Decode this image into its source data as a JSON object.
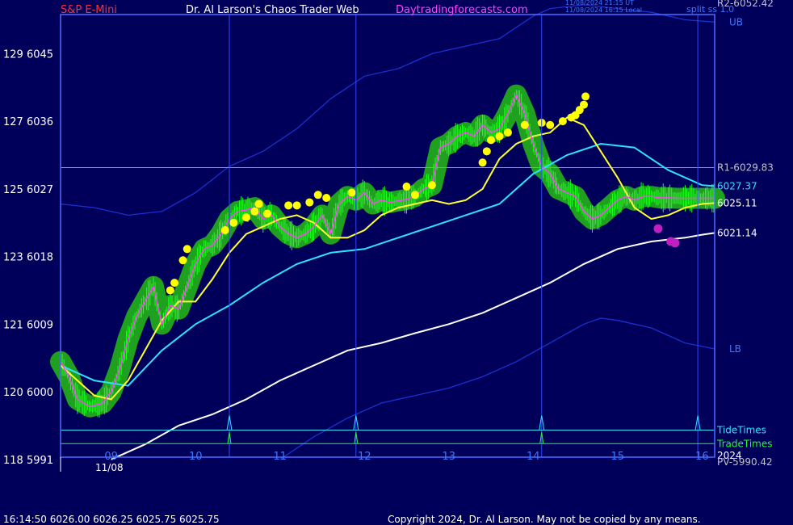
{
  "header": {
    "symbol": "S&P E-Mini",
    "title": "Dr. Al Larson's Chaos Trader Web",
    "site": "Daytradingforecasts.com",
    "time_utc": "11/08/2024 21:15 UT",
    "time_local": "11/08/2024 16:15 Local",
    "split_label": "split ss 1.0"
  },
  "footer": {
    "quote": "16:14:50  6026.00 6026.25 6025.75 6025.75",
    "copyright": "Copyright 2024, Dr. Al Larson. May not be copied by any means."
  },
  "colors": {
    "background": "#00005a",
    "plot_border": "#4a6cff",
    "price": "#ff40ff",
    "price_fast_ma": "#ffff30",
    "mid_ma": "#30e0ff",
    "slow_ma": "#ffffff",
    "band": "#1a30d0",
    "green_zone": "#1fa01f",
    "green_bars": "#20ff20",
    "yellow_dots": "#ffff00",
    "purple_dots": "#c020c0",
    "tide_times": "#30e0ff",
    "trade_times": "#20ff20",
    "r1_line": "#8090ff",
    "time_lines": "#3048ff"
  },
  "chart_data": {
    "type": "line",
    "date_label": "11/08",
    "x_hours": [
      "09",
      "10",
      "11",
      "12",
      "13",
      "14",
      "15",
      "16"
    ],
    "y_axis": {
      "ticks": [
        {
          "value": 5991,
          "label": "118  5991"
        },
        {
          "value": 6000,
          "label": "120  6000"
        },
        {
          "value": 6009,
          "label": "121  6009"
        },
        {
          "value": 6018,
          "label": "123  6018"
        },
        {
          "value": 6027,
          "label": "125  6027"
        },
        {
          "value": 6036,
          "label": "127  6036"
        },
        {
          "value": 6045,
          "label": "129  6045"
        }
      ],
      "min": 5991.3,
      "max": 6050.2
    },
    "x_range": [
      8.4,
      16.15
    ],
    "right_labels": [
      {
        "text": "R2-6052.42",
        "value": 6052.42,
        "color": "#c0c0c0"
      },
      {
        "text": "UB",
        "value": 6049.2,
        "color": "#3a78ff"
      },
      {
        "text": "R1-6029.83",
        "value": 6029.83,
        "color": "#c0c0c0"
      },
      {
        "text": "6027.37",
        "value": 6027.37,
        "color": "#30e0ff"
      },
      {
        "text": "6025.11",
        "value": 6025.11,
        "color": "#ffffff"
      },
      {
        "text": "6021.14",
        "value": 6021.14,
        "color": "#ffffff"
      },
      {
        "text": "LB",
        "value": 6005.7,
        "color": "#3a78ff"
      },
      {
        "text": "TideTimes",
        "value": 5994.9,
        "color": "#30e0ff"
      },
      {
        "text": "TradeTimes",
        "value": 5993.1,
        "color": "#20ff20"
      },
      {
        "text": "2024",
        "value": 5991.5,
        "color": "#ffffff"
      },
      {
        "text": "PV-5990.42",
        "value": 5990.42,
        "color": "#c0c0c0"
      }
    ],
    "reference_lines": [
      {
        "name": "R1",
        "value": 6029.83
      }
    ],
    "vertical_time_lines": [
      10.4,
      11.9,
      14.1,
      15.95
    ],
    "tide_times": [
      10.4,
      11.9,
      14.1,
      15.95
    ],
    "trade_times": [
      10.4,
      11.9,
      14.1
    ],
    "series": [
      {
        "key": "price",
        "x": [
          8.4,
          8.5,
          8.6,
          8.75,
          8.9,
          9.0,
          9.1,
          9.2,
          9.3,
          9.4,
          9.5,
          9.6,
          9.7,
          9.8,
          9.9,
          10.0,
          10.1,
          10.2,
          10.3,
          10.4,
          10.5,
          10.6,
          10.7,
          10.8,
          10.9,
          11.0,
          11.1,
          11.2,
          11.3,
          11.4,
          11.5,
          11.6,
          11.7,
          11.8,
          11.9,
          12.0,
          12.1,
          12.2,
          12.3,
          12.4,
          12.5,
          12.6,
          12.7,
          12.8,
          12.9,
          13.0,
          13.1,
          13.2,
          13.3,
          13.4,
          13.5,
          13.6,
          13.7,
          13.8,
          13.9,
          14.0,
          14.1,
          14.2,
          14.3,
          14.4,
          14.5,
          14.6,
          14.7,
          14.8,
          14.9,
          15.0,
          15.1,
          15.2,
          15.3,
          15.4,
          15.5,
          15.6,
          15.7,
          15.8,
          15.9,
          16.0,
          16.1,
          16.15
        ],
        "y": [
          6004.0,
          6002.0,
          5999.0,
          5998.0,
          5998.5,
          6000.0,
          6003.0,
          6007.0,
          6010.0,
          6012.0,
          6014.0,
          6009.0,
          6011.5,
          6011.0,
          6014.0,
          6017.0,
          6019.0,
          6019.5,
          6021.0,
          6023.0,
          6024.0,
          6024.2,
          6024.5,
          6023.0,
          6023.5,
          6022.0,
          6021.0,
          6020.5,
          6021.0,
          6022.0,
          6023.5,
          6021.0,
          6025.0,
          6026.0,
          6025.5,
          6026.5,
          6025.0,
          6025.5,
          6025.2,
          6025.4,
          6025.6,
          6026.0,
          6027.0,
          6027.5,
          6032.5,
          6033.0,
          6034.0,
          6034.5,
          6034.0,
          6035.5,
          6034.5,
          6035.0,
          6037.0,
          6039.5,
          6037.0,
          6033.0,
          6030.0,
          6029.0,
          6027.0,
          6026.5,
          6026.0,
          6024.0,
          6023.0,
          6023.5,
          6024.5,
          6025.5,
          6026.0,
          6025.5,
          6026.0,
          6026.0,
          6025.8,
          6025.8,
          6025.75,
          6025.75,
          6025.75,
          6025.75,
          6025.75,
          6025.75
        ]
      },
      {
        "key": "fast_ma",
        "x": [
          8.4,
          8.6,
          8.8,
          9.0,
          9.2,
          9.4,
          9.6,
          9.8,
          10.0,
          10.2,
          10.4,
          10.6,
          10.8,
          11.0,
          11.2,
          11.4,
          11.6,
          11.8,
          12.0,
          12.2,
          12.4,
          12.6,
          12.8,
          13.0,
          13.2,
          13.4,
          13.6,
          13.8,
          14.0,
          14.2,
          14.4,
          14.6,
          14.8,
          15.0,
          15.2,
          15.4,
          15.6,
          15.8,
          16.0,
          16.15
        ],
        "y": [
          6003.5,
          6001.5,
          5999.5,
          5999.0,
          6001.5,
          6005.5,
          6009.5,
          6012.0,
          6012.0,
          6015.0,
          6018.5,
          6021.0,
          6022.0,
          6023.0,
          6023.5,
          6022.5,
          6020.5,
          6020.5,
          6021.5,
          6023.5,
          6024.5,
          6025.0,
          6025.5,
          6025.0,
          6025.5,
          6027.0,
          6031.0,
          6033.0,
          6034.0,
          6034.5,
          6036.5,
          6035.5,
          6032.0,
          6028.5,
          6024.5,
          6023.0,
          6023.5,
          6024.5,
          6025.0,
          6025.11
        ]
      },
      {
        "key": "mid_ma",
        "x": [
          8.4,
          8.8,
          9.2,
          9.6,
          10.0,
          10.4,
          10.8,
          11.2,
          11.6,
          12.0,
          12.4,
          12.8,
          13.2,
          13.6,
          14.0,
          14.4,
          14.8,
          15.2,
          15.6,
          16.0,
          16.15
        ],
        "y": [
          6003.5,
          6001.5,
          6000.8,
          6005.5,
          6009.0,
          6011.5,
          6014.5,
          6017.0,
          6018.5,
          6019.0,
          6020.5,
          6022.0,
          6023.5,
          6025.0,
          6029.0,
          6031.5,
          6033.0,
          6032.5,
          6029.5,
          6027.5,
          6027.37
        ]
      },
      {
        "key": "slow_ma",
        "x": [
          9.0,
          9.4,
          9.8,
          10.2,
          10.6,
          11.0,
          11.4,
          11.8,
          12.2,
          12.6,
          13.0,
          13.4,
          13.8,
          14.2,
          14.6,
          15.0,
          15.4,
          15.8,
          16.0,
          16.15
        ],
        "y": [
          5991.0,
          5993.0,
          5995.5,
          5997.0,
          5999.0,
          6001.5,
          6003.5,
          6005.5,
          6006.5,
          6007.8,
          6009.0,
          6010.5,
          6012.5,
          6014.5,
          6017.0,
          6019.0,
          6020.0,
          6020.5,
          6020.9,
          6021.14
        ]
      },
      {
        "key": "upper_band",
        "x": [
          8.4,
          8.8,
          9.2,
          9.6,
          10.0,
          10.4,
          10.8,
          11.2,
          11.6,
          12.0,
          12.4,
          12.8,
          13.2,
          13.6,
          14.0,
          14.2,
          14.6,
          15.0,
          15.4,
          15.8,
          16.15
        ],
        "y": [
          6025.0,
          6024.5,
          6023.5,
          6024.0,
          6026.5,
          6030.0,
          6032.0,
          6035.0,
          6039.0,
          6042.0,
          6043.0,
          6045.0,
          6046.0,
          6047.0,
          6050.0,
          6051.0,
          6051.5,
          6051.0,
          6050.5,
          6049.5,
          6049.2
        ]
      },
      {
        "key": "lower_band",
        "x": [
          11.0,
          11.4,
          11.8,
          12.2,
          12.6,
          13.0,
          13.4,
          13.8,
          14.2,
          14.6,
          14.8,
          15.0,
          15.4,
          15.8,
          16.15
        ],
        "y": [
          5991.0,
          5994.0,
          5996.5,
          5998.5,
          5999.5,
          6000.5,
          6002.0,
          6004.0,
          6006.5,
          6009.0,
          6009.8,
          6009.5,
          6008.5,
          6006.5,
          6005.7
        ]
      }
    ],
    "yellow_dots": [
      {
        "x": 9.7,
        "y": 6013.5
      },
      {
        "x": 9.75,
        "y": 6014.5
      },
      {
        "x": 9.85,
        "y": 6017.5
      },
      {
        "x": 9.9,
        "y": 6019.0
      },
      {
        "x": 10.35,
        "y": 6021.5
      },
      {
        "x": 10.45,
        "y": 6022.5
      },
      {
        "x": 10.6,
        "y": 6023.2
      },
      {
        "x": 10.7,
        "y": 6024.0
      },
      {
        "x": 10.75,
        "y": 6025.0
      },
      {
        "x": 10.85,
        "y": 6023.7
      },
      {
        "x": 11.1,
        "y": 6024.8
      },
      {
        "x": 11.2,
        "y": 6024.8
      },
      {
        "x": 11.35,
        "y": 6025.2
      },
      {
        "x": 11.45,
        "y": 6026.2
      },
      {
        "x": 11.55,
        "y": 6025.8
      },
      {
        "x": 11.85,
        "y": 6026.5
      },
      {
        "x": 12.5,
        "y": 6027.3
      },
      {
        "x": 12.6,
        "y": 6026.2
      },
      {
        "x": 12.8,
        "y": 6027.5
      },
      {
        "x": 13.4,
        "y": 6030.5
      },
      {
        "x": 13.45,
        "y": 6032.0
      },
      {
        "x": 13.5,
        "y": 6033.5
      },
      {
        "x": 13.6,
        "y": 6034.0
      },
      {
        "x": 13.7,
        "y": 6034.5
      },
      {
        "x": 13.9,
        "y": 6035.5
      },
      {
        "x": 14.1,
        "y": 6035.8
      },
      {
        "x": 14.2,
        "y": 6035.5
      },
      {
        "x": 14.35,
        "y": 6036.0
      },
      {
        "x": 14.45,
        "y": 6036.5
      },
      {
        "x": 14.5,
        "y": 6036.8
      },
      {
        "x": 14.55,
        "y": 6037.5
      },
      {
        "x": 14.6,
        "y": 6038.2
      },
      {
        "x": 14.62,
        "y": 6039.3
      }
    ],
    "purple_dots": [
      {
        "x": 15.48,
        "y": 6021.7
      },
      {
        "x": 15.63,
        "y": 6020.0
      },
      {
        "x": 15.68,
        "y": 6019.8
      }
    ]
  }
}
